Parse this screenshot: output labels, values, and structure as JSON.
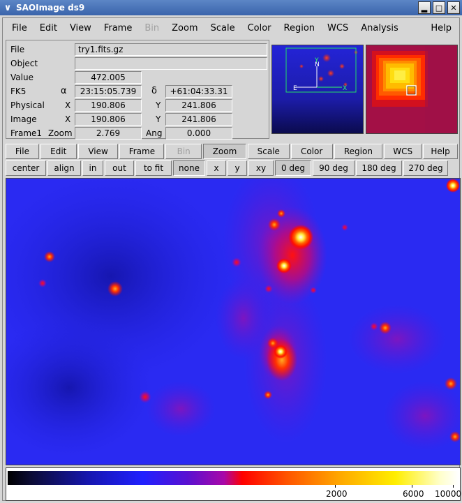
{
  "window": {
    "title": "SAOImage ds9"
  },
  "menu": [
    "File",
    "Edit",
    "View",
    "Frame",
    "Bin",
    "Zoom",
    "Scale",
    "Color",
    "Region",
    "WCS",
    "Analysis",
    "Help"
  ],
  "info": {
    "file_label": "File",
    "file_value": "try1.fits.gz",
    "object_label": "Object",
    "object_value": "",
    "value_label": "Value",
    "value_value": "472.005",
    "fk5_label": "FK5",
    "alpha_symbol": "α",
    "delta_symbol": "δ",
    "ra_value": "23:15:05.739",
    "dec_value": "+61:04:33.31",
    "physical_label": "Physical",
    "physical_x_label": "X",
    "physical_x": "190.806",
    "physical_y_label": "Y",
    "physical_y": "241.806",
    "image_label": "Image",
    "image_x_label": "X",
    "image_x": "190.806",
    "image_y_label": "Y",
    "image_y": "241.806",
    "frame_label": "Frame1",
    "zoom_label": "Zoom",
    "zoom_value": "2.769",
    "angle_label": "Ang",
    "angle_value": "0.000"
  },
  "panner": {
    "north_label": "N",
    "east_label": "E",
    "y_label": "Y",
    "x_label": "X"
  },
  "button_bar": [
    "File",
    "Edit",
    "View",
    "Frame",
    "Bin",
    "Zoom",
    "Scale",
    "Color",
    "Region",
    "WCS",
    "Help"
  ],
  "zoom_buttons": [
    "center",
    "align",
    "in",
    "out",
    "to fit",
    "none",
    "x",
    "y",
    "xy",
    "0 deg",
    "90 deg",
    "180 deg",
    "270 deg"
  ],
  "colorbar": {
    "labels": [
      "2000",
      "6000",
      "10000"
    ]
  }
}
